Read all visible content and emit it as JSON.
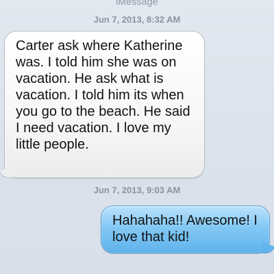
{
  "conversation": {
    "service_label": "iMessage",
    "messages": [
      {
        "timestamp_date": "Jun 7, 2013,",
        "timestamp_time": "8:32 AM",
        "direction": "incoming",
        "text": "Carter ask where Katherine was. I told him she was on vacation. He ask what is vacation. I told him its when you go to the beach. He said I need vacation. I love my little people."
      },
      {
        "timestamp_date": "Jun 7, 2013,",
        "timestamp_time": "9:03 AM",
        "direction": "outgoing",
        "text": "Hahahaha!! Awesome! I love that kid!"
      }
    ]
  },
  "colors": {
    "background": "#dde4ee",
    "incoming_bubble": "#f7f7f7",
    "outgoing_bubble": "#83c8f4",
    "timestamp_text": "#8a93a3"
  }
}
